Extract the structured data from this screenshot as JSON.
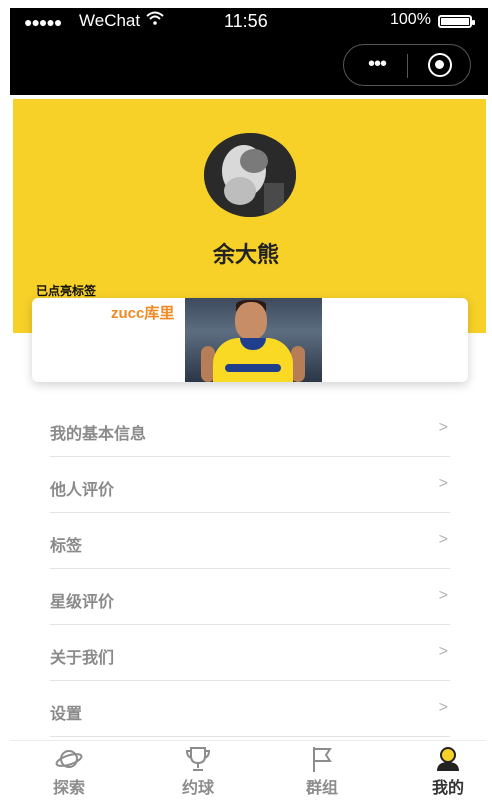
{
  "status_bar": {
    "signal": "●●●●●",
    "carrier": "WeChat",
    "time": "11:56",
    "battery": "100%"
  },
  "capsule": {
    "more": "•••"
  },
  "profile": {
    "name": "余大熊",
    "tags_label": "已点亮标签",
    "tag_name": "zucc库里"
  },
  "menu": {
    "items": [
      {
        "label": "我的基本信息",
        "chevron": ">"
      },
      {
        "label": "他人评价",
        "chevron": ">"
      },
      {
        "label": "标签",
        "chevron": ">"
      },
      {
        "label": "星级评价",
        "chevron": ">"
      },
      {
        "label": "关于我们",
        "chevron": ">"
      },
      {
        "label": "设置",
        "chevron": ">"
      }
    ]
  },
  "tabbar": {
    "items": [
      {
        "label": "探索",
        "icon": "planet-icon"
      },
      {
        "label": "约球",
        "icon": "trophy-icon"
      },
      {
        "label": "群组",
        "icon": "flag-icon"
      },
      {
        "label": "我的",
        "icon": "user-icon"
      }
    ],
    "active": "我的"
  },
  "colors": {
    "header_yellow": "#f7d128",
    "tag_orange": "#f08a24",
    "menu_text": "#8a8a8a"
  }
}
